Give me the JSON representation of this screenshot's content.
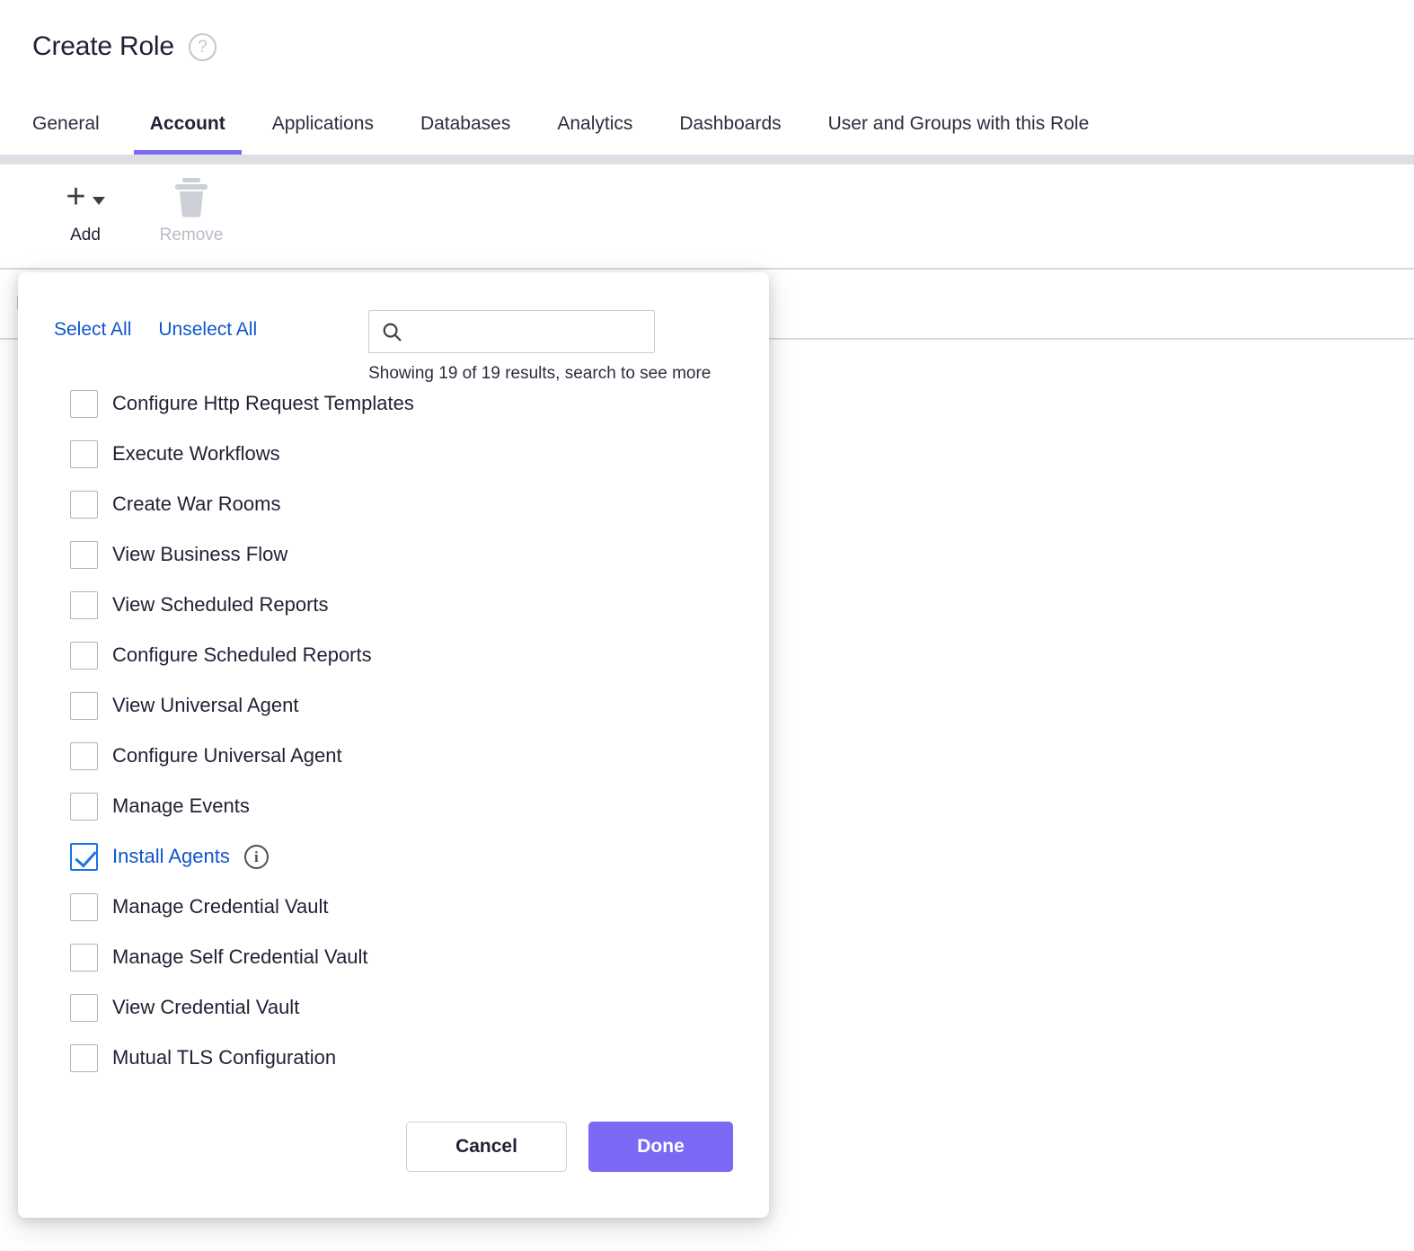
{
  "header": {
    "title": "Create Role",
    "help_icon": "help-circle-icon",
    "help_glyph": "?"
  },
  "tabs": [
    {
      "label": "General",
      "active": false
    },
    {
      "label": "Account",
      "active": true
    },
    {
      "label": "Applications",
      "active": false
    },
    {
      "label": "Databases",
      "active": false
    },
    {
      "label": "Analytics",
      "active": false
    },
    {
      "label": "Dashboards",
      "active": false
    },
    {
      "label": "User and Groups with this Role",
      "active": false
    }
  ],
  "toolbar": {
    "add_label": "Add",
    "add_icon": "plus-icon",
    "add_caret_icon": "chevron-down-icon",
    "remove_label": "Remove",
    "remove_icon": "trash-icon",
    "remove_disabled": true
  },
  "background_table": {
    "column_header": "P"
  },
  "dialog": {
    "select_all_label": "Select All",
    "unselect_all_label": "Unselect All",
    "search": {
      "icon": "search-icon",
      "value": "",
      "placeholder": ""
    },
    "results_text": "Showing 19 of 19 results, search to see more",
    "permissions": [
      {
        "label": "Configure Http Request Templates",
        "checked": false,
        "info": false
      },
      {
        "label": "Execute Workflows",
        "checked": false,
        "info": false
      },
      {
        "label": "Create War Rooms",
        "checked": false,
        "info": false
      },
      {
        "label": "View Business Flow",
        "checked": false,
        "info": false
      },
      {
        "label": "View Scheduled Reports",
        "checked": false,
        "info": false
      },
      {
        "label": "Configure Scheduled Reports",
        "checked": false,
        "info": false
      },
      {
        "label": "View Universal Agent",
        "checked": false,
        "info": false
      },
      {
        "label": "Configure Universal Agent",
        "checked": false,
        "info": false
      },
      {
        "label": "Manage Events",
        "checked": false,
        "info": false
      },
      {
        "label": "Install Agents",
        "checked": true,
        "info": true
      },
      {
        "label": "Manage Credential Vault",
        "checked": false,
        "info": false
      },
      {
        "label": "Manage Self Credential Vault",
        "checked": false,
        "info": false
      },
      {
        "label": "View Credential Vault",
        "checked": false,
        "info": false
      },
      {
        "label": "Mutual TLS Configuration",
        "checked": false,
        "info": false
      }
    ],
    "cancel_label": "Cancel",
    "done_label": "Done"
  },
  "colors": {
    "accent_purple": "#7b68f5",
    "link_blue": "#1155cc",
    "checkbox_blue": "#1a73e8",
    "text_dark": "#1f2233",
    "disabled_grey": "#b7bcc4",
    "border_grey": "#d5d9e0"
  }
}
